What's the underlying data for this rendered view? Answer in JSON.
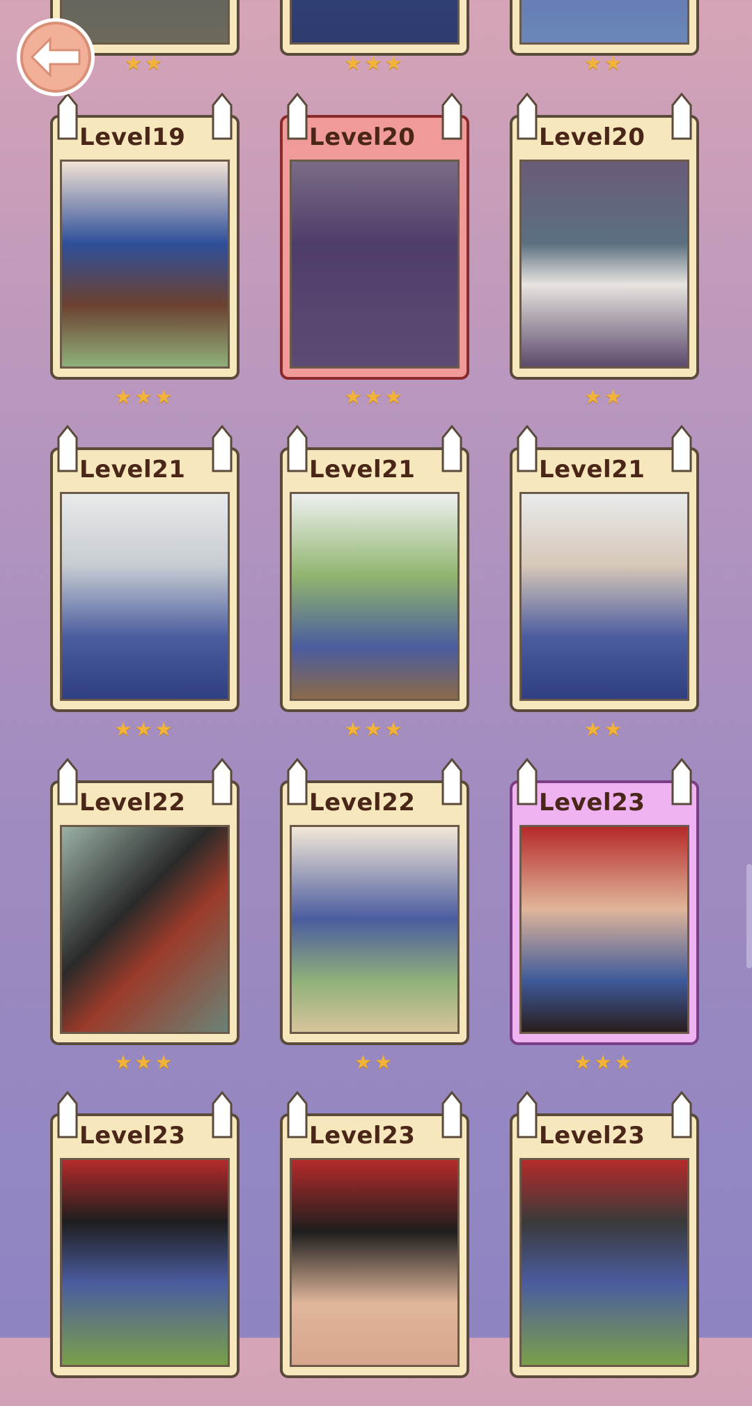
{
  "header": {
    "back_icon": "back-arrow-icon"
  },
  "colors": {
    "card": "#f7e7bd",
    "card_selected_red": "#f09a9a",
    "card_selected_pink": "#efb3f2",
    "star": "#f2b33a"
  },
  "top_partial_cards": [
    {
      "stars": "★★"
    },
    {
      "stars": "★★★"
    },
    {
      "stars": "★★"
    }
  ],
  "cards": [
    {
      "label": "Level19",
      "stars": "★★★",
      "state": "normal"
    },
    {
      "label": "Level20",
      "stars": "★★★",
      "state": "red"
    },
    {
      "label": "Level20",
      "stars": "★★",
      "state": "normal"
    },
    {
      "label": "Level21",
      "stars": "★★★",
      "state": "normal"
    },
    {
      "label": "Level21",
      "stars": "★★★",
      "state": "normal"
    },
    {
      "label": "Level21",
      "stars": "★★",
      "state": "normal"
    },
    {
      "label": "Level22",
      "stars": "★★★",
      "state": "normal"
    },
    {
      "label": "Level22",
      "stars": "★★",
      "state": "normal"
    },
    {
      "label": "Level23",
      "stars": "★★★",
      "state": "pink"
    },
    {
      "label": "Level23",
      "stars": "",
      "state": "normal"
    },
    {
      "label": "Level23",
      "stars": "",
      "state": "normal"
    },
    {
      "label": "Level23",
      "stars": "",
      "state": "normal"
    }
  ]
}
